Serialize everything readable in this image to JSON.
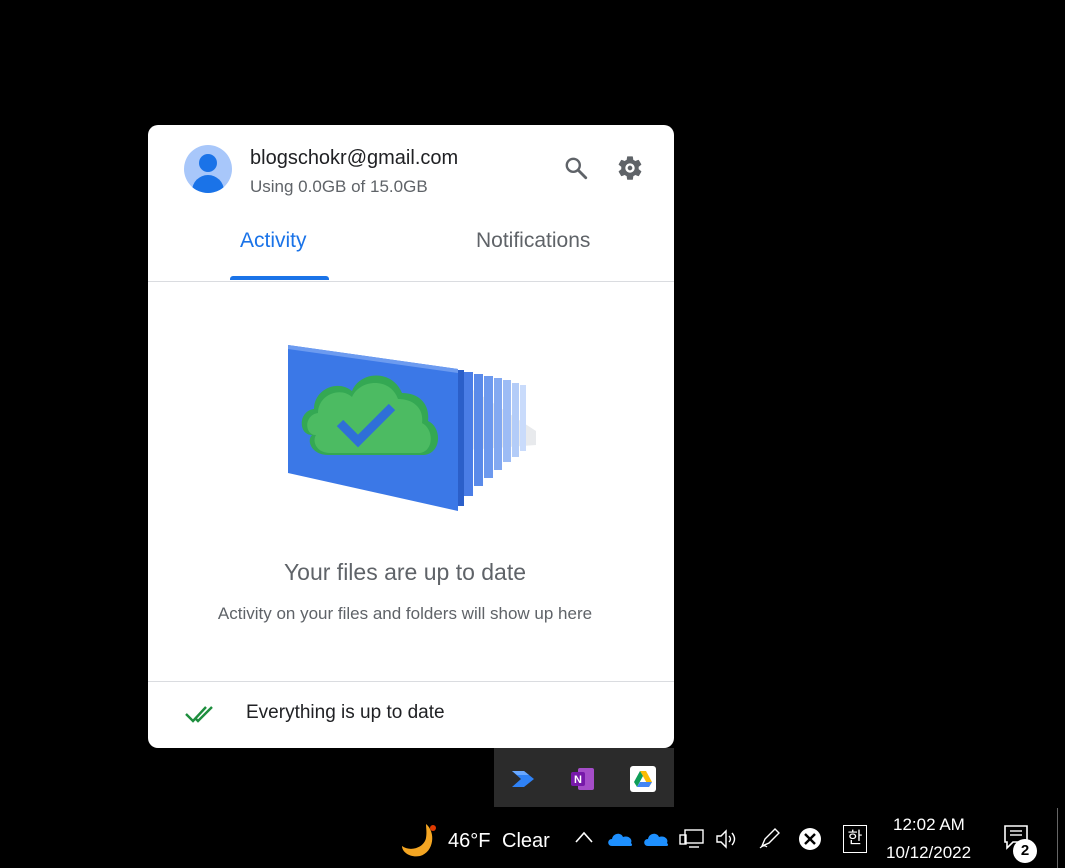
{
  "account": {
    "email": "blogschokr@gmail.com",
    "usage": "Using 0.0GB of 15.0GB"
  },
  "tabs": [
    {
      "label": "Activity",
      "active": true
    },
    {
      "label": "Notifications",
      "active": false
    }
  ],
  "empty_state": {
    "headline": "Your files are up to date",
    "subtext": "Activity on your files and folders will show up here"
  },
  "status": {
    "text": "Everything is up to date"
  },
  "tray_popup": {
    "icons": [
      "power-automate-icon",
      "onenote-icon",
      "google-drive-icon"
    ]
  },
  "taskbar": {
    "weather_temp": "46°F",
    "weather_condition": "Clear",
    "ime_indicator": "한",
    "time": "12:02 AM",
    "date": "10/12/2022",
    "notification_count": "2"
  },
  "colors": {
    "accent": "#1a73e8",
    "check": "#1e8e3e",
    "text_secondary": "#5f6368"
  }
}
